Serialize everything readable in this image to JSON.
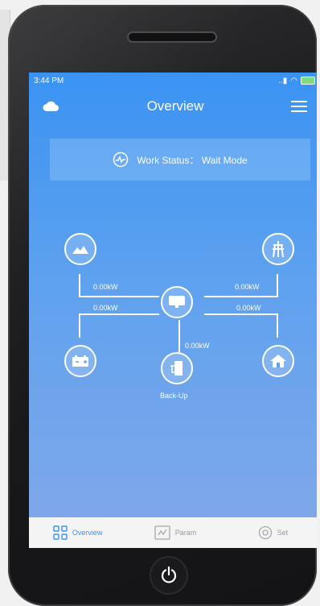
{
  "statusbar": {
    "time": "3:44 PM",
    "signal": "...᪤"
  },
  "header": {
    "title": "Overview"
  },
  "work_status": {
    "label": "Work Status： Wait Mode"
  },
  "flow": {
    "pv_power": "0.00kW",
    "grid_power": "0.00kW",
    "battery_power": "0.00kW",
    "load_power": "0.00kW",
    "backup_power": "0.00kW",
    "backup_label": "Back-Up"
  },
  "tabs": [
    {
      "label": "Overview",
      "active": true
    },
    {
      "label": "Param",
      "active": false
    },
    {
      "label": "Set",
      "active": false
    }
  ],
  "colors": {
    "accent": "#3a93f2",
    "battery": "#7be07b"
  }
}
